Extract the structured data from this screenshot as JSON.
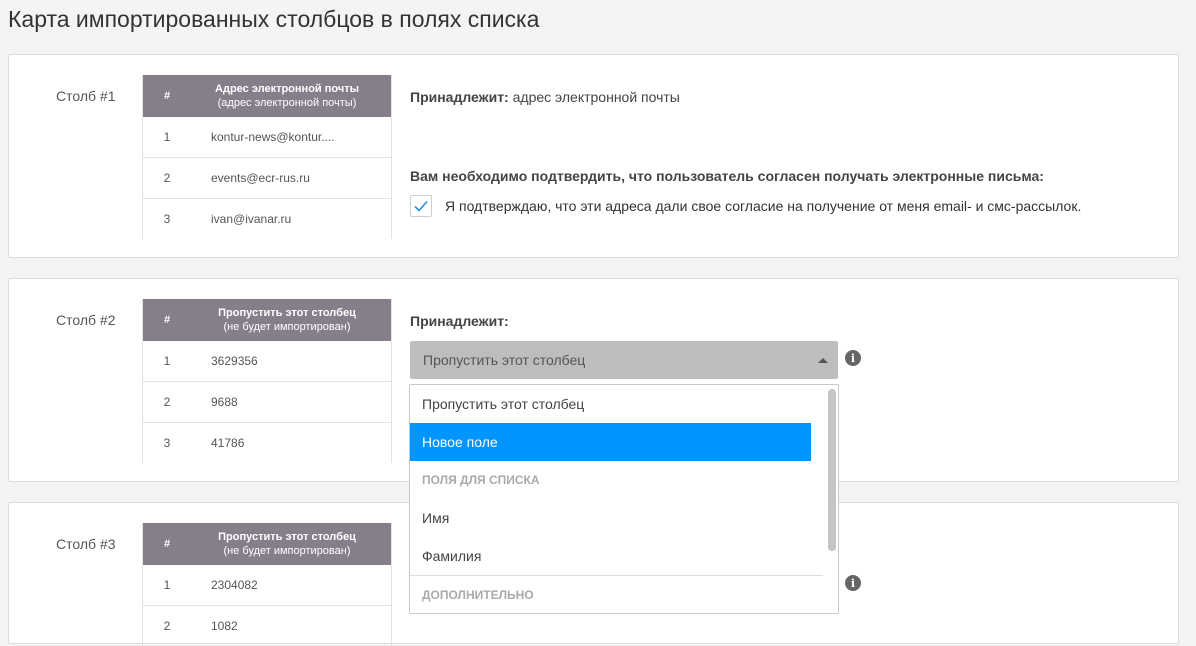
{
  "page": {
    "title": "Карта импортированных столбцов в полях списка"
  },
  "cards": [
    {
      "column_label": "Столб #1",
      "preview": {
        "hash": "#",
        "title": "Адрес электронной почты",
        "subtitle": "(адрес электронной почты)",
        "rows": [
          {
            "num": "1",
            "value": "kontur-news@kontur...."
          },
          {
            "num": "2",
            "value": "events@ecr-rus.ru"
          },
          {
            "num": "3",
            "value": "ivan@ivanar.ru"
          }
        ]
      },
      "belongs_label": "Принадлежит:",
      "belongs_value": "адрес электронной почты",
      "confirm_title": "Вам необходимо подтвердить, что пользователь согласен получать электронные письма:",
      "confirm_checked": true,
      "confirm_label": "Я подтверждаю, что эти адреса дали свое согласие на получение от меня email- и смс-рассылок."
    },
    {
      "column_label": "Столб #2",
      "preview": {
        "hash": "#",
        "title": "Пропустить этот столбец",
        "subtitle": "(не будет импортирован)",
        "rows": [
          {
            "num": "1",
            "value": "3629356"
          },
          {
            "num": "2",
            "value": "9688"
          },
          {
            "num": "3",
            "value": "41786"
          }
        ]
      },
      "belongs_label": "Принадлежит:",
      "select_value": "Пропустить этот столбец"
    },
    {
      "column_label": "Столб #3",
      "preview": {
        "hash": "#",
        "title": "Пропустить этот столбец",
        "subtitle": "(не будет импортирован)",
        "rows": [
          {
            "num": "1",
            "value": "2304082"
          },
          {
            "num": "2",
            "value": "1082"
          }
        ]
      }
    }
  ],
  "dropdown": {
    "items": [
      {
        "type": "option",
        "label": "Пропустить этот столбец"
      },
      {
        "type": "option",
        "label": "Новое поле",
        "highlighted": true
      },
      {
        "type": "group",
        "label": "ПОЛЯ ДЛЯ СПИСКА"
      },
      {
        "type": "option",
        "label": "Имя"
      },
      {
        "type": "option",
        "label": "Фамилия"
      },
      {
        "type": "group",
        "label": "ДОПОЛНИТЕЛЬНО"
      }
    ]
  },
  "colors": {
    "accent": "#0095ff",
    "table_header": "#857f8c",
    "select_bg": "#bdbdbd",
    "checkmark": "#2a8fe0"
  },
  "icons": {
    "info": "info-circle-icon",
    "check": "checkmark-icon",
    "caret": "caret-up-icon"
  }
}
